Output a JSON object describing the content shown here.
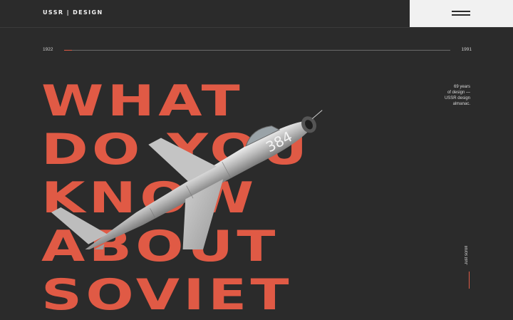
{
  "header": {
    "logo": "USSR | DESIGN",
    "menu_icon": "hamburger-icon"
  },
  "timeline": {
    "start_year": "1922",
    "end_year": "1991",
    "progress": 0.02,
    "accent_color": "#e05a45"
  },
  "caption": {
    "line1": "69 years",
    "line2": "of design —",
    "line3": "USSR design",
    "line4": "almanac."
  },
  "headline": {
    "lines": [
      "WHAT",
      "DO YOU",
      "KNOW",
      "ABOUT",
      "SOVIET"
    ]
  },
  "hero": {
    "aircraft_number": "384",
    "image_icon": "fighter-jet-illustration"
  },
  "scroll_hint": {
    "label": "Just scroll"
  },
  "colors": {
    "background": "#2b2b2b",
    "accent": "#e05a45",
    "menu_bg": "#f1f1f1"
  }
}
